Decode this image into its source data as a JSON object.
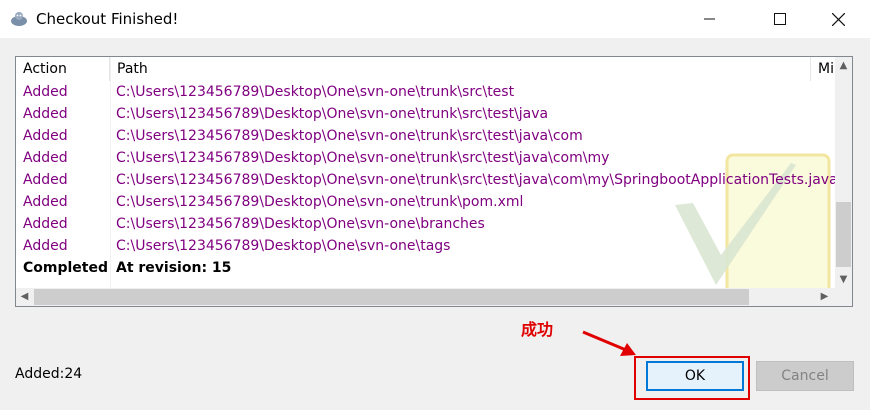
{
  "window": {
    "title": "Checkout Finished!"
  },
  "controls": {
    "minimize": "—",
    "maximize": "☐",
    "close": "✕"
  },
  "list": {
    "columns": [
      "Action",
      "Path",
      "Mi"
    ],
    "rows": [
      {
        "action": "Added",
        "path": "C:\\Users\\123456789\\Desktop\\One\\svn-one\\trunk\\src\\test"
      },
      {
        "action": "Added",
        "path": "C:\\Users\\123456789\\Desktop\\One\\svn-one\\trunk\\src\\test\\java"
      },
      {
        "action": "Added",
        "path": "C:\\Users\\123456789\\Desktop\\One\\svn-one\\trunk\\src\\test\\java\\com"
      },
      {
        "action": "Added",
        "path": "C:\\Users\\123456789\\Desktop\\One\\svn-one\\trunk\\src\\test\\java\\com\\my"
      },
      {
        "action": "Added",
        "path": "C:\\Users\\123456789\\Desktop\\One\\svn-one\\trunk\\src\\test\\java\\com\\my\\SpringbootApplicationTests.java"
      },
      {
        "action": "Added",
        "path": "C:\\Users\\123456789\\Desktop\\One\\svn-one\\trunk\\pom.xml"
      },
      {
        "action": "Added",
        "path": "C:\\Users\\123456789\\Desktop\\One\\svn-one\\branches"
      },
      {
        "action": "Added",
        "path": "C:\\Users\\123456789\\Desktop\\One\\svn-one\\tags"
      },
      {
        "action": "Completed",
        "path": "At revision: 15"
      }
    ]
  },
  "status_text": "Added:24",
  "annotation": "成功",
  "buttons": {
    "ok": "OK",
    "cancel": "Cancel"
  },
  "colors": {
    "added": "#800080",
    "highlight": "#e00000",
    "accent": "#0078d7"
  }
}
